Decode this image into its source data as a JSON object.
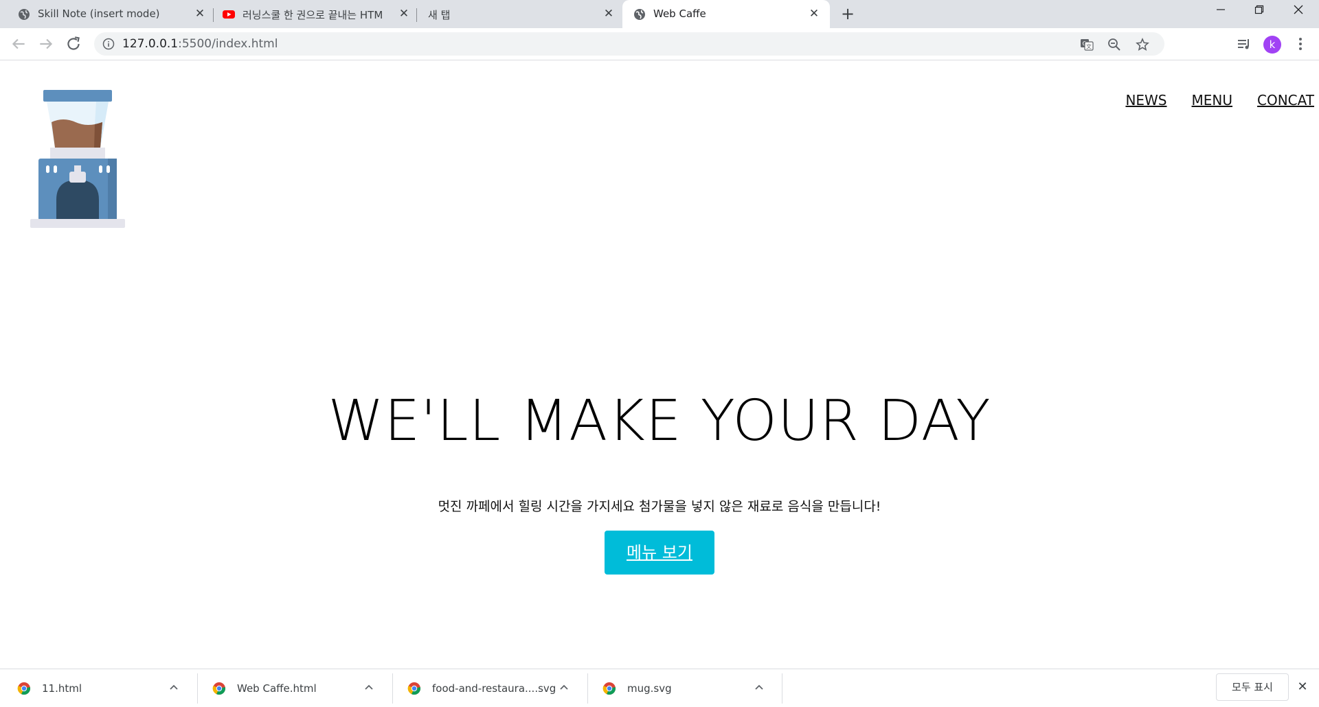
{
  "browser": {
    "tabs": [
      {
        "title": "Skill Note (insert mode)",
        "icon": "globe-icon"
      },
      {
        "title": "러닝스쿨 한 권으로 끝내는 HTM",
        "icon": "youtube-icon"
      },
      {
        "title": "새 탭",
        "icon": "none"
      },
      {
        "title": "Web Caffe",
        "icon": "globe-icon",
        "active": true
      }
    ],
    "url_host": "127.0.0.1",
    "url_rest": ":5500/index.html",
    "profile_initial": "k",
    "profile_color": "#a142f4"
  },
  "page": {
    "logo_icon": "coffee-machine-icon",
    "nav": [
      "NEWS",
      "MENU",
      "CONCAT"
    ],
    "hero_title": "WE'LL MAKE YOUR DAY",
    "hero_subtitle": "멋진 까페에서 힐링 시간을 가지세요 첨가물을 넣지 않은 재료로 음식을 만듭니다!",
    "cta_label": "메뉴 보기",
    "cta_color": "#00bcd9"
  },
  "downloads": {
    "items": [
      "11.html",
      "Web Caffe.html",
      "food-and-restaura....svg",
      "mug.svg"
    ],
    "show_all": "모두 표시"
  }
}
